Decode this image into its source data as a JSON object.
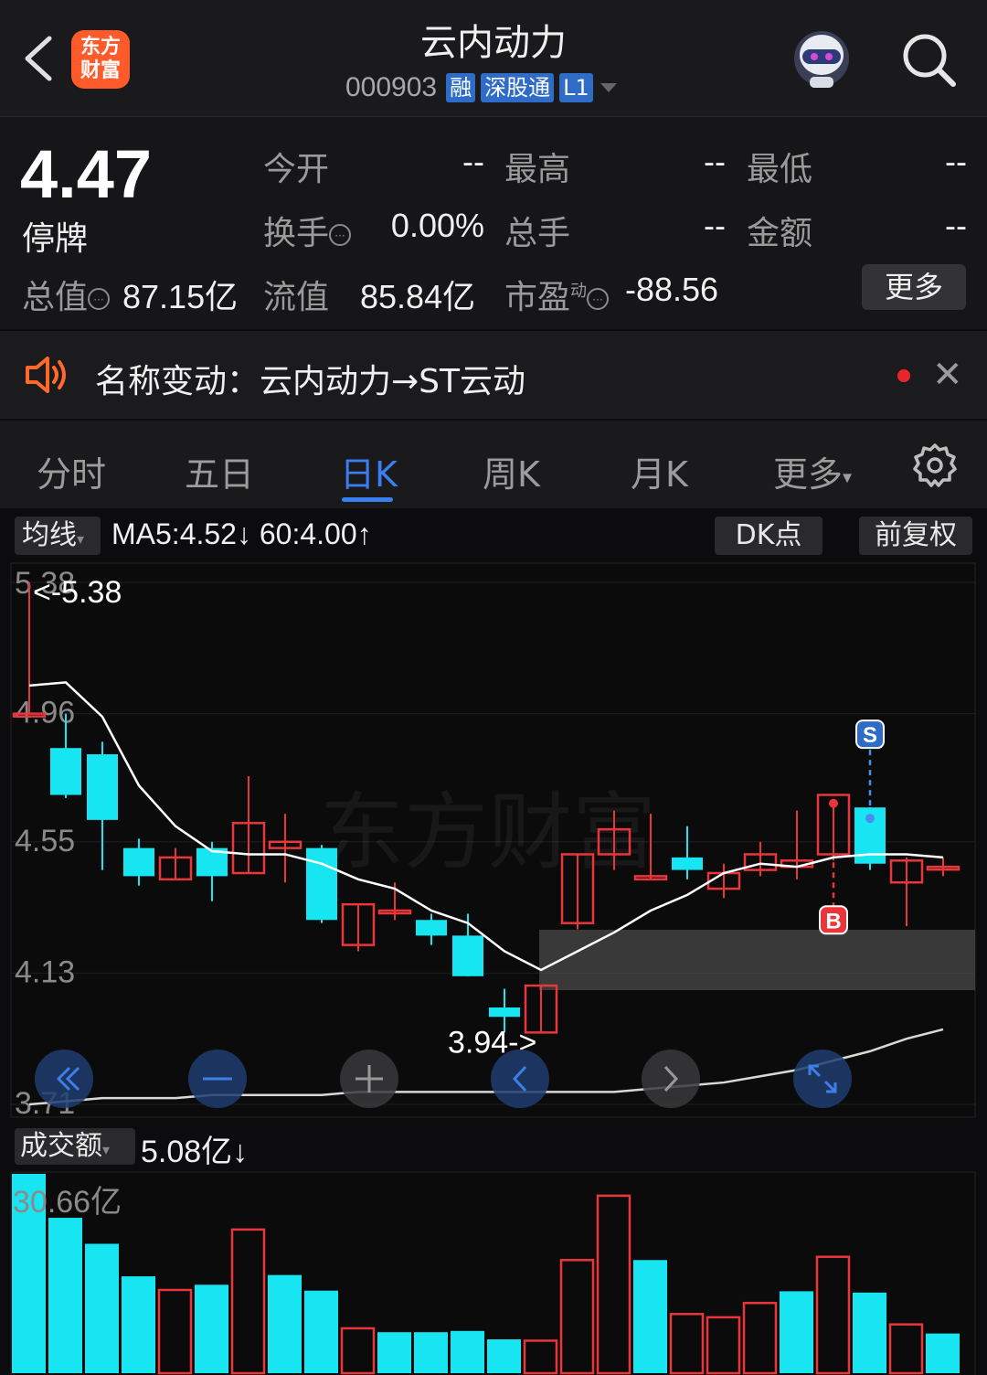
{
  "header": {
    "logo_line1": "东方",
    "logo_line2": "财富",
    "title": "云内动力",
    "code": "000903",
    "tags": [
      "融",
      "深股通",
      "L1"
    ]
  },
  "quote": {
    "price": "4.47",
    "status": "停牌",
    "open_label": "今开",
    "open_value": "--",
    "high_label": "最高",
    "high_value": "--",
    "low_label": "最低",
    "low_value": "--",
    "turnover_label": "换手",
    "turnover_value": "0.00%",
    "volume_label": "总手",
    "volume_value": "--",
    "amount_label": "金额",
    "amount_value": "--",
    "mktcap_label": "总值",
    "mktcap_value": "87.15亿",
    "float_label": "流值",
    "float_value": "85.84亿",
    "pe_label": "市盈",
    "pe_sup": "动",
    "pe_value": "-88.56",
    "more_label": "更多"
  },
  "notice": {
    "text": "名称变动：云内动力→ST云动"
  },
  "tabs": [
    {
      "label": "分时"
    },
    {
      "label": "五日"
    },
    {
      "label": "日K"
    },
    {
      "label": "周K"
    },
    {
      "label": "月K"
    },
    {
      "label": "更多"
    }
  ],
  "active_tab": "日K",
  "chart_toolbar": {
    "ma_selector": "均线",
    "ma_text": "MA5:4.52↓ 60:4.00↑",
    "dk_label": "DK点",
    "adjust_label": "前复权",
    "volume_selector": "成交额",
    "volume_text": "5.08亿↓"
  },
  "colors": {
    "up": "#e8363b",
    "down": "#17e6f2",
    "accent": "#3a7ff0",
    "ma_line": "#ffffff"
  },
  "chart_data": {
    "type": "candlestick",
    "y_ticks": [
      "5.38",
      "4.96",
      "4.55",
      "4.13",
      "3.71"
    ],
    "ylim": [
      3.71,
      5.38
    ],
    "max_label": "<-5.38",
    "min_label": "3.94->",
    "signals": [
      {
        "label": "S",
        "candle": 23
      },
      {
        "label": "B",
        "candle": 22
      }
    ],
    "candles": [
      {
        "o": 4.96,
        "h": 5.38,
        "l": 4.96,
        "c": 4.96
      },
      {
        "o": 4.85,
        "h": 4.96,
        "l": 4.69,
        "c": 4.7
      },
      {
        "o": 4.83,
        "h": 4.87,
        "l": 4.46,
        "c": 4.62
      },
      {
        "o": 4.53,
        "h": 4.56,
        "l": 4.41,
        "c": 4.44
      },
      {
        "o": 4.43,
        "h": 4.53,
        "l": 4.43,
        "c": 4.5
      },
      {
        "o": 4.53,
        "h": 4.55,
        "l": 4.36,
        "c": 4.44
      },
      {
        "o": 4.45,
        "h": 4.76,
        "l": 4.45,
        "c": 4.61
      },
      {
        "o": 4.53,
        "h": 4.64,
        "l": 4.42,
        "c": 4.55
      },
      {
        "o": 4.53,
        "h": 4.54,
        "l": 4.29,
        "c": 4.3
      },
      {
        "o": 4.22,
        "h": 4.35,
        "l": 4.2,
        "c": 4.35
      },
      {
        "o": 4.33,
        "h": 4.42,
        "l": 4.3,
        "c": 4.33
      },
      {
        "o": 4.3,
        "h": 4.32,
        "l": 4.22,
        "c": 4.25
      },
      {
        "o": 4.25,
        "h": 4.32,
        "l": 4.12,
        "c": 4.12
      },
      {
        "o": 4.02,
        "h": 4.08,
        "l": 3.94,
        "c": 3.99
      },
      {
        "o": 3.94,
        "h": 4.09,
        "l": 3.94,
        "c": 4.09
      },
      {
        "o": 4.29,
        "h": 4.51,
        "l": 4.27,
        "c": 4.51
      },
      {
        "o": 4.51,
        "h": 4.65,
        "l": 4.46,
        "c": 4.59
      },
      {
        "o": 4.43,
        "h": 4.64,
        "l": 4.43,
        "c": 4.44
      },
      {
        "o": 4.5,
        "h": 4.6,
        "l": 4.43,
        "c": 4.46
      },
      {
        "o": 4.4,
        "h": 4.48,
        "l": 4.37,
        "c": 4.45
      },
      {
        "o": 4.46,
        "h": 4.55,
        "l": 4.44,
        "c": 4.51
      },
      {
        "o": 4.47,
        "h": 4.65,
        "l": 4.43,
        "c": 4.49
      },
      {
        "o": 4.51,
        "h": 4.67,
        "l": 4.49,
        "c": 4.7
      },
      {
        "o": 4.66,
        "h": 4.66,
        "l": 4.46,
        "c": 4.48
      },
      {
        "o": 4.42,
        "h": 4.5,
        "l": 4.28,
        "c": 4.49
      },
      {
        "o": 4.47,
        "h": 4.5,
        "l": 4.44,
        "c": 4.47
      }
    ],
    "ma5": [
      5.05,
      5.06,
      4.95,
      4.73,
      4.6,
      4.52,
      4.51,
      4.51,
      4.48,
      4.43,
      4.4,
      4.33,
      4.29,
      4.2,
      4.14,
      4.2,
      4.26,
      4.33,
      4.38,
      4.45,
      4.48,
      4.47,
      4.5,
      4.51,
      4.51,
      4.5
    ],
    "ma60": [
      3.71,
      3.72,
      3.73,
      3.73,
      3.73,
      3.74,
      3.74,
      3.74,
      3.74,
      3.75,
      3.75,
      3.75,
      3.75,
      3.75,
      3.75,
      3.75,
      3.75,
      3.76,
      3.77,
      3.78,
      3.8,
      3.82,
      3.85,
      3.88,
      3.92,
      3.95
    ],
    "volume_max_label": "30.66亿",
    "volume": [
      30.66,
      23.9,
      19.9,
      14.9,
      12.8,
      13.6,
      22.1,
      15.1,
      12.7,
      6.9,
      6.3,
      6.3,
      6.5,
      5.2,
      5.0,
      17.4,
      27.3,
      17.4,
      9.1,
      8.6,
      10.8,
      12.6,
      17.9,
      12.4,
      7.5,
      6.1
    ],
    "volume_up": [
      false,
      false,
      false,
      false,
      true,
      false,
      true,
      false,
      false,
      true,
      false,
      false,
      false,
      false,
      true,
      true,
      true,
      false,
      true,
      true,
      true,
      false,
      true,
      false,
      true,
      false
    ]
  }
}
